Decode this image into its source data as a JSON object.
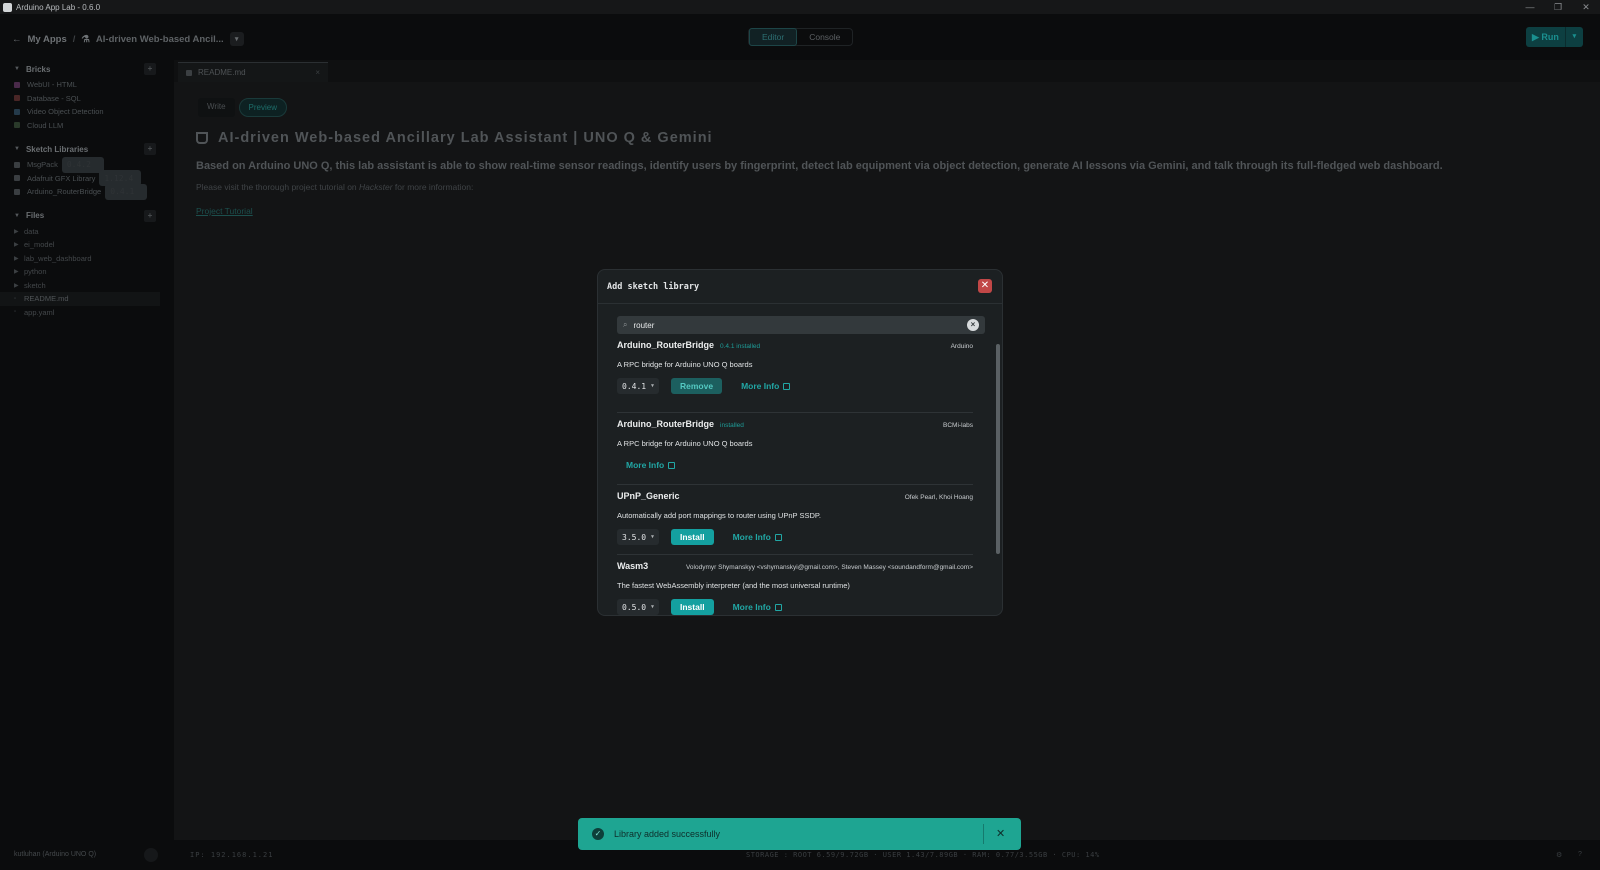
{
  "window": {
    "title": "Arduino App Lab - 0.6.0",
    "controls": [
      "—",
      "❐",
      "✕"
    ]
  },
  "appbar": {
    "back_label": "My Apps",
    "app_name": "AI-driven Web-based Ancil...",
    "mode_editor": "Editor",
    "mode_console": "Console",
    "run_label": "▶ Run"
  },
  "sidebar": {
    "bricks_title": "Bricks",
    "bricks": [
      "WebUI - HTML",
      "Database - SQL",
      "Video Object Detection",
      "Cloud LLM"
    ],
    "libs_title": "Sketch Libraries",
    "libs": [
      {
        "name": "MsgPack",
        "version": "0.4.2"
      },
      {
        "name": "Adafruit GFX Library",
        "version": "1.12.4"
      },
      {
        "name": "Arduino_RouterBridge",
        "version": "0.4.1"
      }
    ],
    "files_title": "Files",
    "folders": [
      "data",
      "ei_model",
      "lab_web_dashboard",
      "python",
      "sketch"
    ],
    "files": [
      "README.md",
      "app.yaml"
    ]
  },
  "editor": {
    "tab_name": "README.md",
    "write_label": "Write",
    "preview_label": "Preview",
    "heading": "AI-driven Web-based Ancillary Lab Assistant | UNO Q & Gemini",
    "lead": "Based on Arduino UNO Q, this lab assistant is able to show real-time sensor readings, identify users by fingerprint, detect lab equipment via object detection, generate AI lessons via Gemini, and talk through its full-fledged web dashboard.",
    "note_before": "Please visit the thorough project tutorial on ",
    "note_em": "Hackster",
    "note_after": " for more information:",
    "link": "Project Tutorial"
  },
  "modal": {
    "title": "Add sketch library",
    "search_value": "router",
    "libraries": [
      {
        "name": "Arduino_RouterBridge",
        "badge": "0.4.1 installed",
        "author": "Arduino",
        "desc": "A RPC bridge for Arduino UNO Q boards",
        "version": "0.4.1",
        "action": "Remove",
        "more": "More Info"
      },
      {
        "name": "Arduino_RouterBridge",
        "badge": "installed",
        "author": "BCMi-labs",
        "desc": "A RPC bridge for Arduino UNO Q boards",
        "version": "",
        "action": "",
        "more": "More Info"
      },
      {
        "name": "UPnP_Generic",
        "badge": "",
        "author": "Ofek Pearl, Khoi Hoang",
        "desc": "Automatically add port mappings to router using UPnP SSDP.",
        "version": "3.5.0",
        "action": "Install",
        "more": "More Info"
      },
      {
        "name": "Wasm3",
        "badge": "",
        "author": "Volodymyr Shymanskyy <vshymanskyi@gmail.com>, Steven Massey <soundandform@gmail.com>",
        "desc": "The fastest WebAssembly interpreter (and the most universal runtime)",
        "version": "0.5.0",
        "action": "Install",
        "more": "More Info"
      }
    ]
  },
  "toast": {
    "message": "Library added successfully"
  },
  "statusbar": {
    "board": "kutluhan (Arduino UNO Q)",
    "ip": "IP: 192.168.1.21",
    "stats": "STORAGE : ROOT 6.59/9.72GB · USER 1.43/7.89GB · RAM: 0.77/3.55GB · CPU: 14%"
  },
  "colors": {
    "accent": "#14a0a0",
    "toast": "#1ea592",
    "close": "#c14747",
    "installed_badge": "#1e9c98"
  }
}
